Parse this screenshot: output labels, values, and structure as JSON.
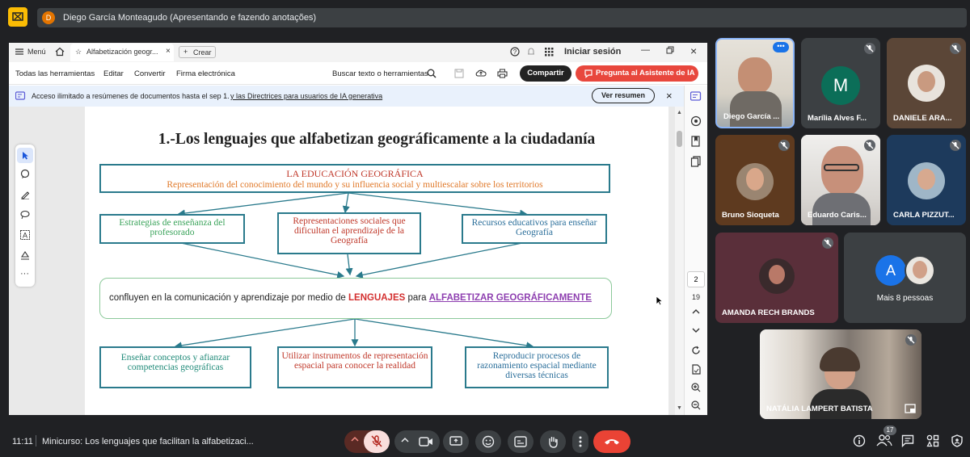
{
  "presenter_bar": {
    "initial": "D",
    "text": "Diego García Monteagudo (Apresentando e fazendo anotações)"
  },
  "pdf": {
    "menu_label": "Menú",
    "tab_title": "Alfabetización geogr...",
    "new_tab_label": "Crear",
    "signin_label": "Iniciar sesión",
    "toolbar": {
      "all_tools": "Todas las herramientas",
      "edit": "Editar",
      "convert": "Convertir",
      "esign": "Firma electrónica",
      "search": "Buscar texto o herramientas",
      "share": "Compartir",
      "ai": "Pregunta al Asistente de IA"
    },
    "banner": {
      "text": "Acceso ilimitado a resúmenes de documentos hasta el sep 1.",
      "link": "y las Directrices para usuarios de IA generativa",
      "button": "Ver resumen"
    },
    "page_current": "2",
    "page_total": "19"
  },
  "slide": {
    "title": "1.-Los lenguajes que alfabetizan geográficamente a la ciudadanía",
    "top_box": {
      "title": "LA EDUCACIÓN GEOGRÁFICA",
      "subtitle": "Representación del conocimiento del mundo y su influencia social y multiescalar sobre los territorios"
    },
    "box_left": "Estrategias de enseñanza del profesorado",
    "box_mid": "Representaciones sociales que dificultan el aprendizaje de la Geografía",
    "box_right": "Recursos educativos para enseñar Geografía",
    "center_text_a": "confluyen en la comunicación y aprendizaje por medio de ",
    "center_text_b": "LENGUAJES",
    "center_text_c": " para ",
    "center_text_d": "ALFABETIZAR GEOGRÁFICAMENTE",
    "bottom_left": "Enseñar conceptos y afianzar competencias geográficas",
    "bottom_mid": "Utilizar instrumentos de representación espacial para conocer la realidad",
    "bottom_right": "Reproducir procesos de razonamiento espacial mediante diversas técnicas"
  },
  "participants": [
    {
      "name": "Diego García ...",
      "kind": "video"
    },
    {
      "name": "Marília Alves F...",
      "initial": "M",
      "bg": "#0b6e58"
    },
    {
      "name": "DANIELE ARA...",
      "bg": "#5b4637"
    },
    {
      "name": "Bruno Sioqueta",
      "bg": "#5e3a1f"
    },
    {
      "name": "Eduardo Caris...",
      "kind": "video"
    },
    {
      "name": "CARLA PIZZUT...",
      "bg": "#1d3a5c"
    },
    {
      "name": "AMANDA RECH BRANDS",
      "bg": "#5a2f3a"
    },
    {
      "name": "Mais 8 pessoas",
      "initial": "A"
    },
    {
      "name": "NATÁLIA LAMPERT BATISTA",
      "kind": "video"
    }
  ],
  "meeting": {
    "time": "11:11",
    "title": "Minicurso: Los lenguajes que facilitan la alfabetizaci...",
    "people_count": "17"
  },
  "colors": {
    "teal": "#2a7a8c",
    "green_text": "#3aa35a",
    "red_text": "#c0392b",
    "blue_text": "#2a6e9a",
    "end_call": "#ea4335",
    "ai_button": "#e8473d"
  }
}
